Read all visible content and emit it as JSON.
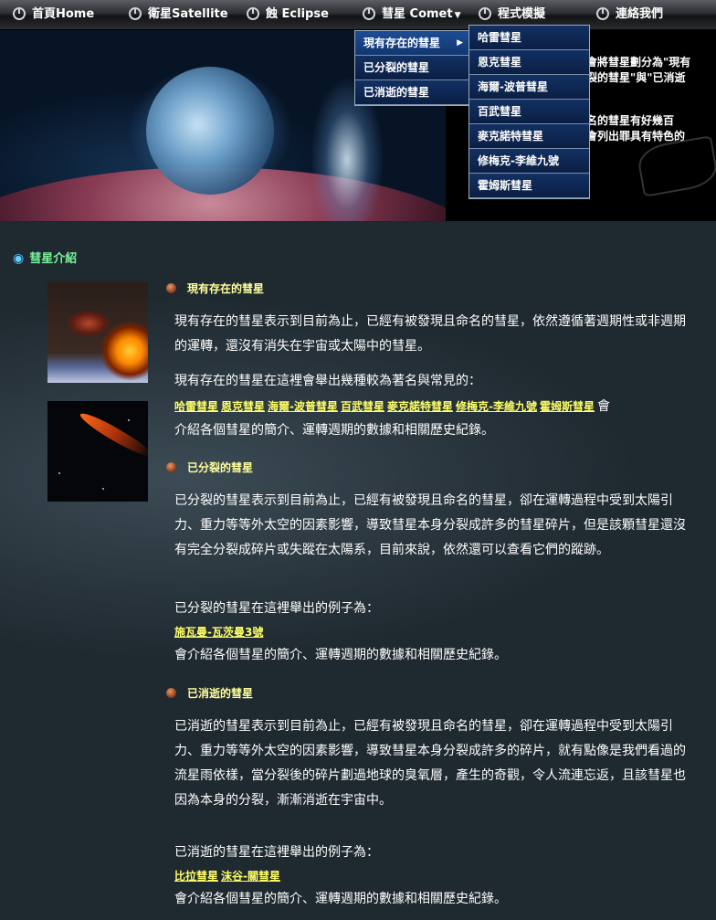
{
  "nav": {
    "items": [
      {
        "label": "首頁Home"
      },
      {
        "label": "衛星Satellite"
      },
      {
        "label": "蝕 Eclipse"
      },
      {
        "label": "彗星 Comet"
      },
      {
        "label": "程式模擬"
      },
      {
        "label": "連絡我們"
      }
    ]
  },
  "comet_menu": {
    "items": [
      {
        "label": "現有存在的彗星"
      },
      {
        "label": "已分裂的彗星"
      },
      {
        "label": "已消逝的彗星"
      }
    ]
  },
  "comet_submenu": {
    "items": [
      {
        "label": "哈雷彗星"
      },
      {
        "label": "恩克彗星"
      },
      {
        "label": "海爾-波普彗星"
      },
      {
        "label": "百武彗星"
      },
      {
        "label": "麥克諾特彗星"
      },
      {
        "label": "修梅克-李維九號"
      },
      {
        "label": "霍姆斯彗星"
      }
    ]
  },
  "hero": {
    "text_lines_1": [
      "會將彗星劃分為\"現有",
      "裂的彗星\"與\"已消逝"
    ],
    "text_lines_2": [
      "名的彗星有好幾百",
      "會列出罪具有特色的"
    ]
  },
  "main": {
    "section_title": "彗星介紹",
    "existing": {
      "title": "現有存在的彗星",
      "para1": "現有存在的彗星表示到目前為止，已經有被發現且命名的彗星，依然遵循著週期性或非週期的運轉，還沒有消失在宇宙或太陽中的彗星。",
      "para2": "現有存在的彗星在這裡會舉出幾種較為著名與常見的：",
      "links": [
        "哈雷彗星",
        "恩克彗星",
        "海爾-波普彗星",
        "百武彗星",
        "麥克諾特彗星",
        "修梅克-李維九號",
        "霍姆斯彗星"
      ],
      "links_suffix": "會",
      "para3": "介紹各個彗星的簡介、運轉週期的數據和相關歷史紀錄。"
    },
    "split": {
      "title": "已分裂的彗星",
      "para1": "已分裂的彗星表示到目前為止，已經有被發現且命名的彗星，卻在運轉過程中受到太陽引力、重力等等外太空的因素影響，導致彗星本身分裂成許多的彗星碎片，但是該顆彗星還沒有完全分裂成碎片或失蹤在太陽系，目前來說，依然還可以查看它們的蹤跡。",
      "para2": "已分裂的彗星在這裡舉出的例子為：",
      "links": [
        "施瓦曼-瓦茨曼3號"
      ],
      "para3": "會介紹各個彗星的簡介、運轉週期的數據和相關歷史紀錄。"
    },
    "vanished": {
      "title": "已消逝的彗星",
      "para1": "已消逝的彗星表示到目前為止，已經有被發現且命名的彗星，卻在運轉過程中受到太陽引力、重力等等外太空的因素影響，導致彗星本身分裂成許多的碎片，就有點像是我們看過的流星雨依樣，當分裂後的碎片劃過地球的臭氧層，產生的奇觀，令人流連忘返，且該彗星也因為本身的分裂，漸漸消逝在宇宙中。",
      "para2": "已消逝的彗星在這裡舉出的例子為：",
      "links": [
        "比拉彗星",
        "沫谷-關彗星"
      ],
      "para3": "會介紹各個彗星的簡介、運轉週期的數據和相關歷史紀錄。"
    }
  },
  "colors": {
    "accent_link": "#ffff66",
    "section_title": "#7bf29a",
    "menu_bg": "#0b1f44"
  }
}
